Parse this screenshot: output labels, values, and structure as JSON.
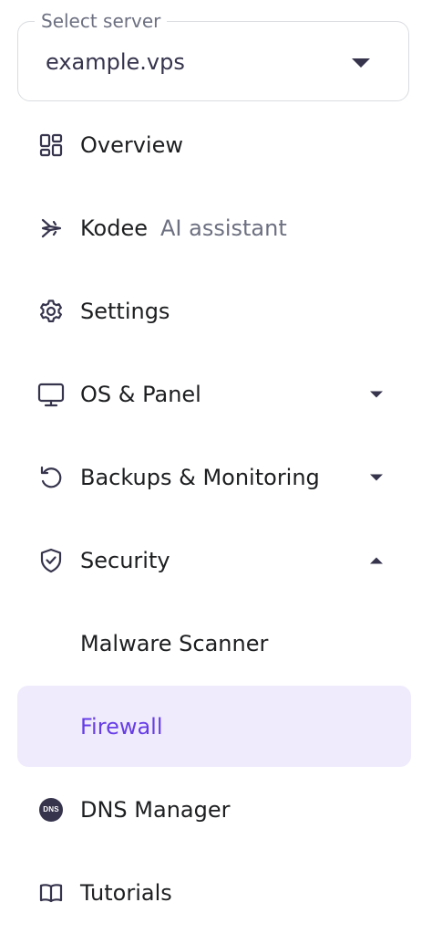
{
  "server": {
    "label": "Select server",
    "value": "example.vps"
  },
  "nav": {
    "overview": "Overview",
    "kodee": "Kodee",
    "kodee_hint": "AI assistant",
    "settings": "Settings",
    "os_panel": "OS & Panel",
    "backups": "Backups & Monitoring",
    "security": "Security",
    "malware": "Malware Scanner",
    "firewall": "Firewall",
    "dns": "DNS Manager",
    "dns_badge": "DNS",
    "tutorials": "Tutorials"
  },
  "colors": {
    "accent": "#673de6",
    "active_bg": "#efebfd",
    "text": "#1d1e20",
    "muted": "#6d7081",
    "icon": "#36344d"
  },
  "icons": {
    "overview": "dashboard-grid-icon",
    "kodee": "kodee-sparkle-icon",
    "settings": "gear-icon",
    "os_panel": "monitor-icon",
    "backups": "restore-icon",
    "security": "shield-check-icon",
    "dns": "dns-icon",
    "tutorials": "book-icon"
  }
}
